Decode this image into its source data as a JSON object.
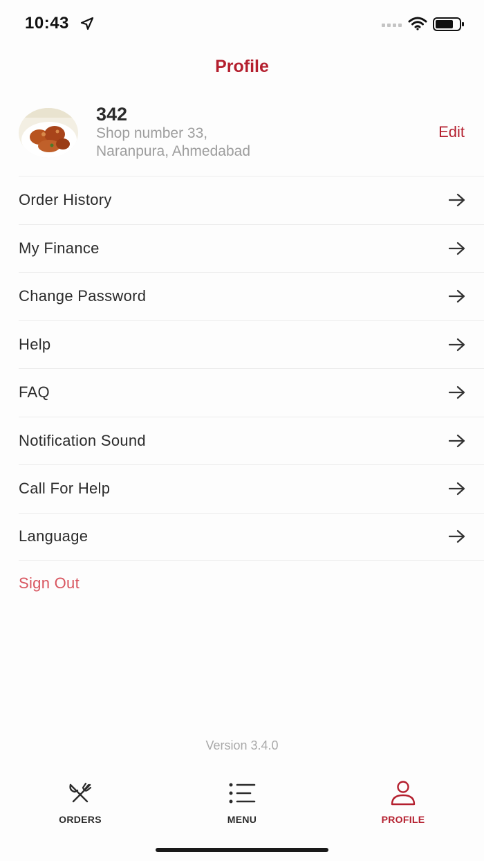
{
  "status_bar": {
    "time": "10:43"
  },
  "header": {
    "title": "Profile"
  },
  "profile": {
    "shop_name": "342",
    "address_line1": "Shop number 33,",
    "address_line2": "Naranpura, Ahmedabad",
    "edit_label": "Edit"
  },
  "menu": {
    "items": [
      {
        "label": "Order History"
      },
      {
        "label": "My Finance"
      },
      {
        "label": "Change Password"
      },
      {
        "label": "Help"
      },
      {
        "label": "FAQ"
      },
      {
        "label": "Notification Sound"
      },
      {
        "label": "Call For Help"
      },
      {
        "label": "Language"
      }
    ],
    "sign_out": "Sign Out"
  },
  "version": "Version 3.4.0",
  "tab_bar": {
    "tabs": [
      {
        "label": "ORDERS",
        "icon": "fork-knife-icon"
      },
      {
        "label": "MENU",
        "icon": "list-icon"
      },
      {
        "label": "PROFILE",
        "icon": "user-icon",
        "active": true
      }
    ]
  },
  "colors": {
    "accent": "#b41f2e",
    "sign_out": "#d8555f",
    "muted": "#9d9d9d"
  }
}
